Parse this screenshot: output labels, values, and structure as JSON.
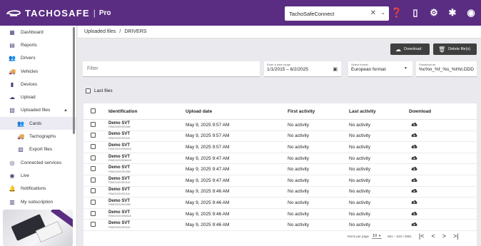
{
  "app": {
    "brand": "TACHOSAFE",
    "separator": "|",
    "edition": "Pro",
    "company": "TachoSafeConnect",
    "clear_glyph": "✕",
    "chevron_glyph": "⌄"
  },
  "top_icons": [
    {
      "name": "more-vert-icon",
      "glyph": "⋮"
    },
    {
      "name": "help-icon",
      "glyph": "❓"
    },
    {
      "name": "mobile-icon",
      "glyph": "▯"
    },
    {
      "name": "gear-icon",
      "glyph": "⚙"
    },
    {
      "name": "uk-flag-icon",
      "glyph": "✱"
    },
    {
      "name": "account-icon",
      "glyph": "◉"
    }
  ],
  "sidebar": {
    "items": [
      {
        "name": "dashboard",
        "icon": "dashboard-icon",
        "glyph": "▦",
        "label": "Dashboard"
      },
      {
        "name": "reports",
        "icon": "report-icon",
        "glyph": "▤",
        "label": "Reports"
      },
      {
        "name": "drivers",
        "icon": "people-icon",
        "glyph": "👥",
        "label": "Drivers"
      },
      {
        "name": "vehicles",
        "icon": "truck-icon",
        "glyph": "🚚",
        "label": "Vehicles"
      },
      {
        "name": "devices",
        "icon": "device-icon",
        "glyph": "▮",
        "label": "Devices"
      },
      {
        "name": "upload",
        "icon": "cloud-upload-icon",
        "glyph": "☁",
        "label": "Upload"
      },
      {
        "name": "uploaded-files",
        "icon": "files-icon",
        "glyph": "▧",
        "label": "Uploaded files",
        "caret": "▲"
      },
      {
        "name": "cards",
        "icon": "people-icon",
        "glyph": "👥",
        "label": "Cards",
        "sub": true,
        "active": true
      },
      {
        "name": "tachographs",
        "icon": "truck-icon",
        "glyph": "🚚",
        "label": "Tachographs",
        "sub": true
      },
      {
        "name": "export-files",
        "icon": "files-icon",
        "glyph": "▧",
        "label": "Export files",
        "sub": true
      },
      {
        "name": "connected-services",
        "icon": "link-icon",
        "glyph": "◎",
        "label": "Connected services"
      },
      {
        "name": "live",
        "icon": "live-icon",
        "glyph": "◉",
        "label": "Live"
      },
      {
        "name": "notifications",
        "icon": "bell-icon",
        "glyph": "🔔",
        "label": "Notifications"
      },
      {
        "name": "my-subscription",
        "icon": "store-icon",
        "glyph": "▥",
        "label": "My subscription"
      }
    ]
  },
  "breadcrumb": {
    "parent": "Uploaded files",
    "sep": "/",
    "current": "DRIVERS"
  },
  "toolbar": {
    "download_label": "Download",
    "delete_label": "Delete file(s)",
    "download_glyph": "☁",
    "delete_glyph": "🗑"
  },
  "filters": {
    "filter_placeholder": "Filter",
    "date_label": "Enter a date range",
    "date_value": "1/1/2015 – 6/2/2025",
    "calendar_glyph": "▣",
    "format_label": "Select format",
    "format_value": "European format",
    "format_chevron": "▼",
    "dlname_label": "Download as",
    "dlname_value": "%c%n_%f_%s_%t%t.DDD"
  },
  "last_files_label": "Last files",
  "table": {
    "headers": {
      "identification": "Identification",
      "upload_date": "Upload date",
      "first_activity": "First activity",
      "last_activity": "Last activity",
      "download": "Download"
    },
    "rows": [
      {
        "name": "Demo SVT",
        "code": "F0MC0G2V20V280",
        "date": "May 9, 2025 9:57 AM",
        "first": "No activity",
        "last": "No activity"
      },
      {
        "name": "Demo SVT",
        "code": "F0MC0G2V20V110",
        "date": "May 9, 2025 9:57 AM",
        "first": "No activity",
        "last": "No activity"
      },
      {
        "name": "Demo SVT",
        "code": "F0MC0G2V20W418",
        "date": "May 9, 2025 9:57 AM",
        "first": "No activity",
        "last": "No activity"
      },
      {
        "name": "Demo SVT",
        "code": "F0MC0G2V20W418",
        "date": "May 9, 2025 9:47 AM",
        "first": "No activity",
        "last": "No activity"
      },
      {
        "name": "Demo SVT",
        "code": "F0MC0G2V20V280",
        "date": "May 9, 2025 9:47 AM",
        "first": "No activity",
        "last": "No activity"
      },
      {
        "name": "Demo SVT",
        "code": "F0MC0G2V20V110",
        "date": "May 9, 2025 9:47 AM",
        "first": "No activity",
        "last": "No activity"
      },
      {
        "name": "Demo SVT",
        "code": "F0MC0G2V20V110",
        "date": "May 9, 2025 9:46 AM",
        "first": "No activity",
        "last": "No activity"
      },
      {
        "name": "Demo SVT",
        "code": "F0MC0G2V20V280",
        "date": "May 9, 2025 9:46 AM",
        "first": "No activity",
        "last": "No activity"
      },
      {
        "name": "Demo SVT",
        "code": "F0MC0G2V20W418",
        "date": "May 9, 2025 9:46 AM",
        "first": "No activity",
        "last": "No activity"
      },
      {
        "name": "Demo SVT",
        "code": "F0MC0G2V20V110",
        "date": "May 9, 2025 9:46 AM",
        "first": "No activity",
        "last": "No activity"
      }
    ]
  },
  "pager": {
    "items_per_page_label": "Items per page",
    "items_per_page": "10",
    "select_glyph": "▼",
    "range": "601 – 610 / 2961",
    "first_glyph": "|<",
    "prev_glyph": "<",
    "next_glyph": ">",
    "last_glyph": ">|"
  },
  "colors": {
    "brand": "#5a2d82",
    "button": "#3f3f3f",
    "download_icon": "#3d3d3d"
  }
}
